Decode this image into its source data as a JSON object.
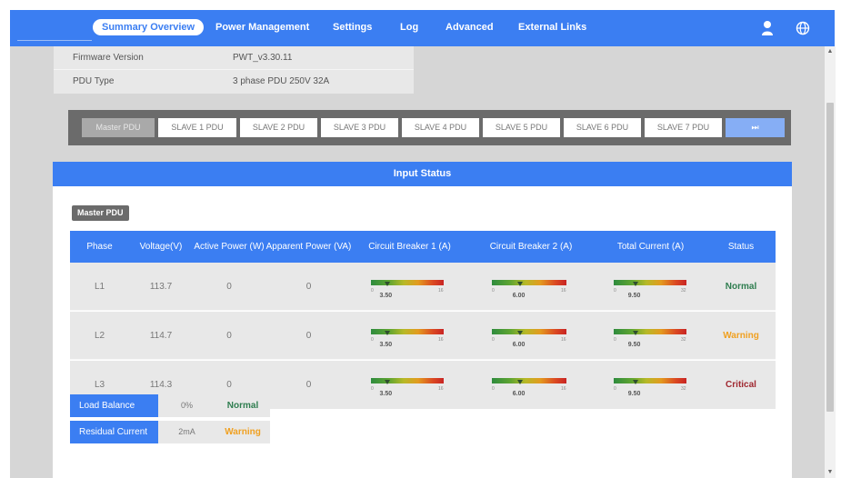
{
  "nav": {
    "items": [
      "Summary Overview",
      "Power Management",
      "Settings",
      "Log",
      "Advanced",
      "External Links"
    ],
    "icons": [
      "user-icon",
      "globe-icon"
    ]
  },
  "device_info": {
    "rows": [
      {
        "label": "Firmware Version",
        "value": "PWT_v3.30.11"
      },
      {
        "label": "PDU Type",
        "value": "3 phase PDU 250V 32A"
      }
    ]
  },
  "pdu_tabs": {
    "items": [
      "Master PDU",
      "SLAVE 1 PDU",
      "SLAVE 2 PDU",
      "SLAVE 3 PDU",
      "SLAVE 4 PDU",
      "SLAVE 5 PDU",
      "SLAVE 6 PDU",
      "SLAVE 7 PDU"
    ],
    "next_symbol": "⏭",
    "active_index": 0
  },
  "input_status": {
    "title": "Input Status",
    "badge": "Master PDU",
    "columns": [
      "Phase",
      "Voltage(V)",
      "Active Power (W)",
      "Apparent Power (VA)",
      "Circuit Breaker 1 (A)",
      "Circuit Breaker 2 (A)",
      "Total Current (A)",
      "Status"
    ],
    "rows": [
      {
        "phase": "L1",
        "voltage": "113.7",
        "active_power": "0",
        "apparent_power": "0",
        "cb1": "3.50",
        "cb2": "6.00",
        "total": "9.50",
        "status": "Normal"
      },
      {
        "phase": "L2",
        "voltage": "114.7",
        "active_power": "0",
        "apparent_power": "0",
        "cb1": "3.50",
        "cb2": "6.00",
        "total": "9.50",
        "status": "Warning"
      },
      {
        "phase": "L3",
        "voltage": "114.3",
        "active_power": "0",
        "apparent_power": "0",
        "cb1": "3.50",
        "cb2": "6.00",
        "total": "9.50",
        "status": "Critical"
      }
    ],
    "gauges": {
      "cb1": {
        "min": "0",
        "max": "16"
      },
      "cb2": {
        "min": "0",
        "max": "16"
      },
      "total": {
        "min": "0",
        "max": "32"
      }
    }
  },
  "summary": [
    {
      "label": "Load Balance",
      "value": "0%",
      "status": "Normal"
    },
    {
      "label": "Residual Current",
      "value": "2mA",
      "status": "Warning"
    }
  ],
  "colors": {
    "accent": "#3b7ef2",
    "normal": "#2e7d4f",
    "warning": "#f0a020",
    "critical": "#a02830"
  }
}
